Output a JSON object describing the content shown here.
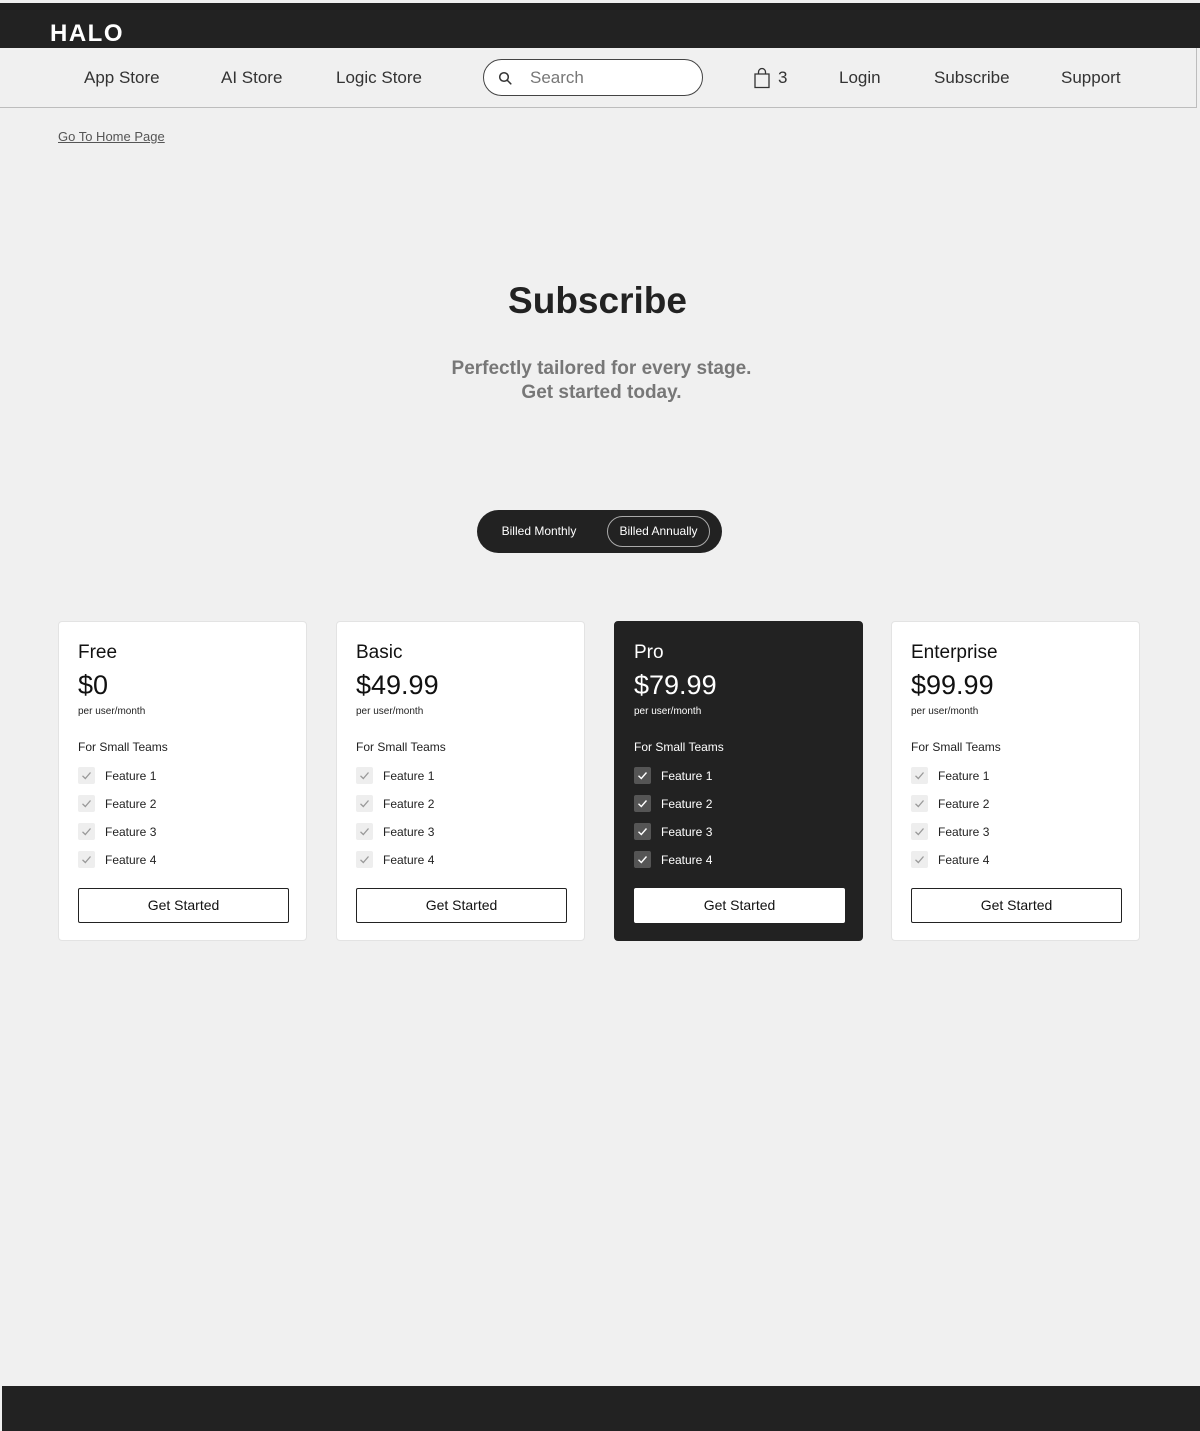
{
  "brand": {
    "logo": "HALO"
  },
  "nav": {
    "links": [
      "App Store",
      "AI Store",
      "Logic Store"
    ],
    "search_placeholder": "Search",
    "cart_count": "3",
    "login": "Login",
    "subscribe": "Subscribe",
    "support": "Support"
  },
  "breadcrumb": {
    "home": "Go To Home Page"
  },
  "hero": {
    "title": "Subscribe",
    "subtitle_line1": "Perfectly tailored for every stage.",
    "subtitle_line2": "Get started today."
  },
  "billing_toggle": {
    "monthly": "Billed Monthly",
    "annually": "Billed Annually",
    "selected": "annually"
  },
  "plans": [
    {
      "name": "Free",
      "price": "$0",
      "period": "per user/month",
      "audience": "For Small Teams",
      "features": [
        "Feature 1",
        "Feature 2",
        "Feature 3",
        "Feature 4"
      ],
      "cta": "Get Started"
    },
    {
      "name": "Basic",
      "price": "$49.99",
      "period": "per user/month",
      "audience": "For Small Teams",
      "features": [
        "Feature 1",
        "Feature 2",
        "Feature 3",
        "Feature 4"
      ],
      "cta": "Get Started"
    },
    {
      "name": "Pro",
      "price": "$79.99",
      "period": "per user/month",
      "audience": "For Small Teams",
      "features": [
        "Feature 1",
        "Feature 2",
        "Feature 3",
        "Feature 4"
      ],
      "cta": "Get Started"
    },
    {
      "name": "Enterprise",
      "price": "$99.99",
      "period": "per user/month",
      "audience": "For Small Teams",
      "features": [
        "Feature 1",
        "Feature 2",
        "Feature 3",
        "Feature 4"
      ],
      "cta": "Get Started"
    }
  ],
  "colors": {
    "dark": "#222222",
    "background": "#f0f0f0",
    "card": "#ffffff",
    "muted_text": "#777777"
  },
  "icons": {
    "search": "search-icon",
    "cart": "shopping-bag-icon",
    "check": "check-icon"
  }
}
